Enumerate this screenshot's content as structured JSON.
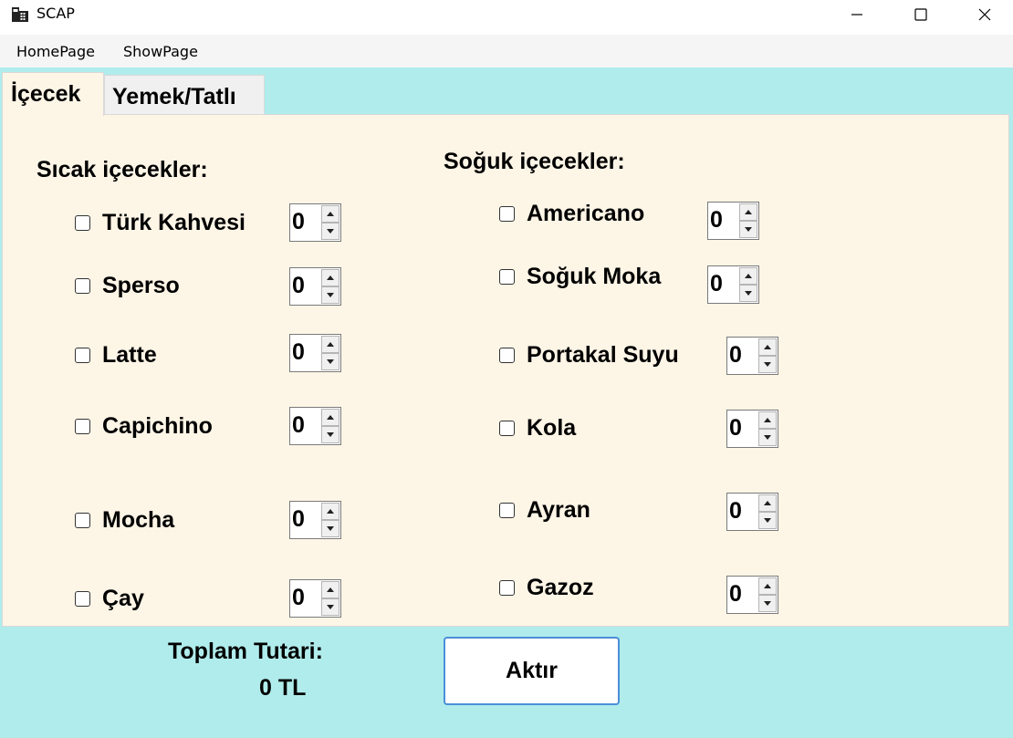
{
  "window": {
    "title": "SCAP",
    "icon": "calculator-app-icon"
  },
  "menu": [
    "HomePage",
    "ShowPage"
  ],
  "tabs": [
    {
      "label": "İçecek",
      "active": true
    },
    {
      "label": "Yemek/Tatlı",
      "active": false
    }
  ],
  "hot_drinks": {
    "heading": "Sıcak içecekler:",
    "items": [
      {
        "label": "Türk Kahvesi",
        "checked": false,
        "qty": "0"
      },
      {
        "label": "Sperso",
        "checked": false,
        "qty": "0"
      },
      {
        "label": "Latte",
        "checked": false,
        "qty": "0"
      },
      {
        "label": "Capichino",
        "checked": false,
        "qty": "0"
      },
      {
        "label": "Mocha",
        "checked": false,
        "qty": "0"
      },
      {
        "label": "Çay",
        "checked": false,
        "qty": "0"
      }
    ]
  },
  "cold_drinks": {
    "heading": "Soğuk içecekler:",
    "items": [
      {
        "label": "Americano",
        "checked": false,
        "qty": "0"
      },
      {
        "label": "Soğuk Moka",
        "checked": false,
        "qty": "0"
      },
      {
        "label": "Portakal Suyu",
        "checked": false,
        "qty": "0"
      },
      {
        "label": "Kola",
        "checked": false,
        "qty": "0"
      },
      {
        "label": "Ayran",
        "checked": false,
        "qty": "0"
      },
      {
        "label": "Gazoz",
        "checked": false,
        "qty": "0"
      }
    ]
  },
  "total": {
    "label": "Toplam Tutari:",
    "value": "0 TL"
  },
  "action_button": "Aktır",
  "colors": {
    "background": "#b0ecec",
    "panel": "#fdf5e6",
    "button_border": "#4a8fd8"
  }
}
